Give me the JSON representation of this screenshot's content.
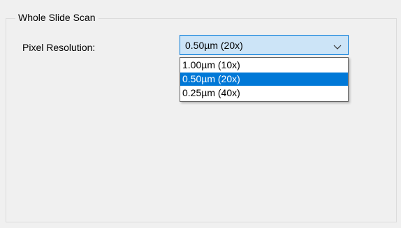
{
  "group": {
    "title": "Whole Slide Scan"
  },
  "pixel_resolution": {
    "label": "Pixel Resolution:",
    "selected": "0.50µm (20x)",
    "options": [
      "1.00µm (10x)",
      "0.50µm (20x)",
      "0.25µm (40x)"
    ],
    "highlighted_index": 1
  },
  "icons": {
    "combo_arrow": "chevron-down-icon"
  },
  "colors": {
    "accent": "#0078d7",
    "combo_fill": "#cce4f7",
    "background": "#f0f0f0"
  }
}
